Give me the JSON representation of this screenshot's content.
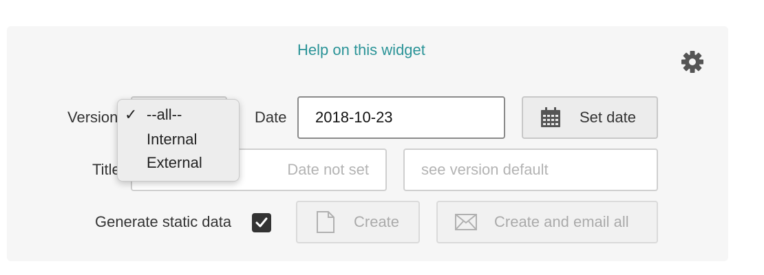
{
  "widget": {
    "help_link": "Help on this widget",
    "settings_icon": "gear-icon"
  },
  "form": {
    "version_label": "Version",
    "version_dropdown": {
      "selected": "--all--",
      "options": [
        "--all--",
        "Internal",
        "External"
      ]
    },
    "date_label": "Date",
    "date_value": "2018-10-23",
    "set_date_label": "Set date",
    "set_date_icon": "calendar-icon",
    "title_label": "Title",
    "date_not_set_placeholder": "Date not set",
    "version_default_placeholder": "see version default",
    "generate_static_label": "Generate static data",
    "generate_static_checked": true,
    "create_label": "Create",
    "create_icon": "document-icon",
    "create_email_label": "Create and email all",
    "create_email_icon": "envelope-icon"
  },
  "colors": {
    "link": "#2a9397",
    "panel_bg": "#f6f6f6",
    "checkbox": "#333333"
  }
}
